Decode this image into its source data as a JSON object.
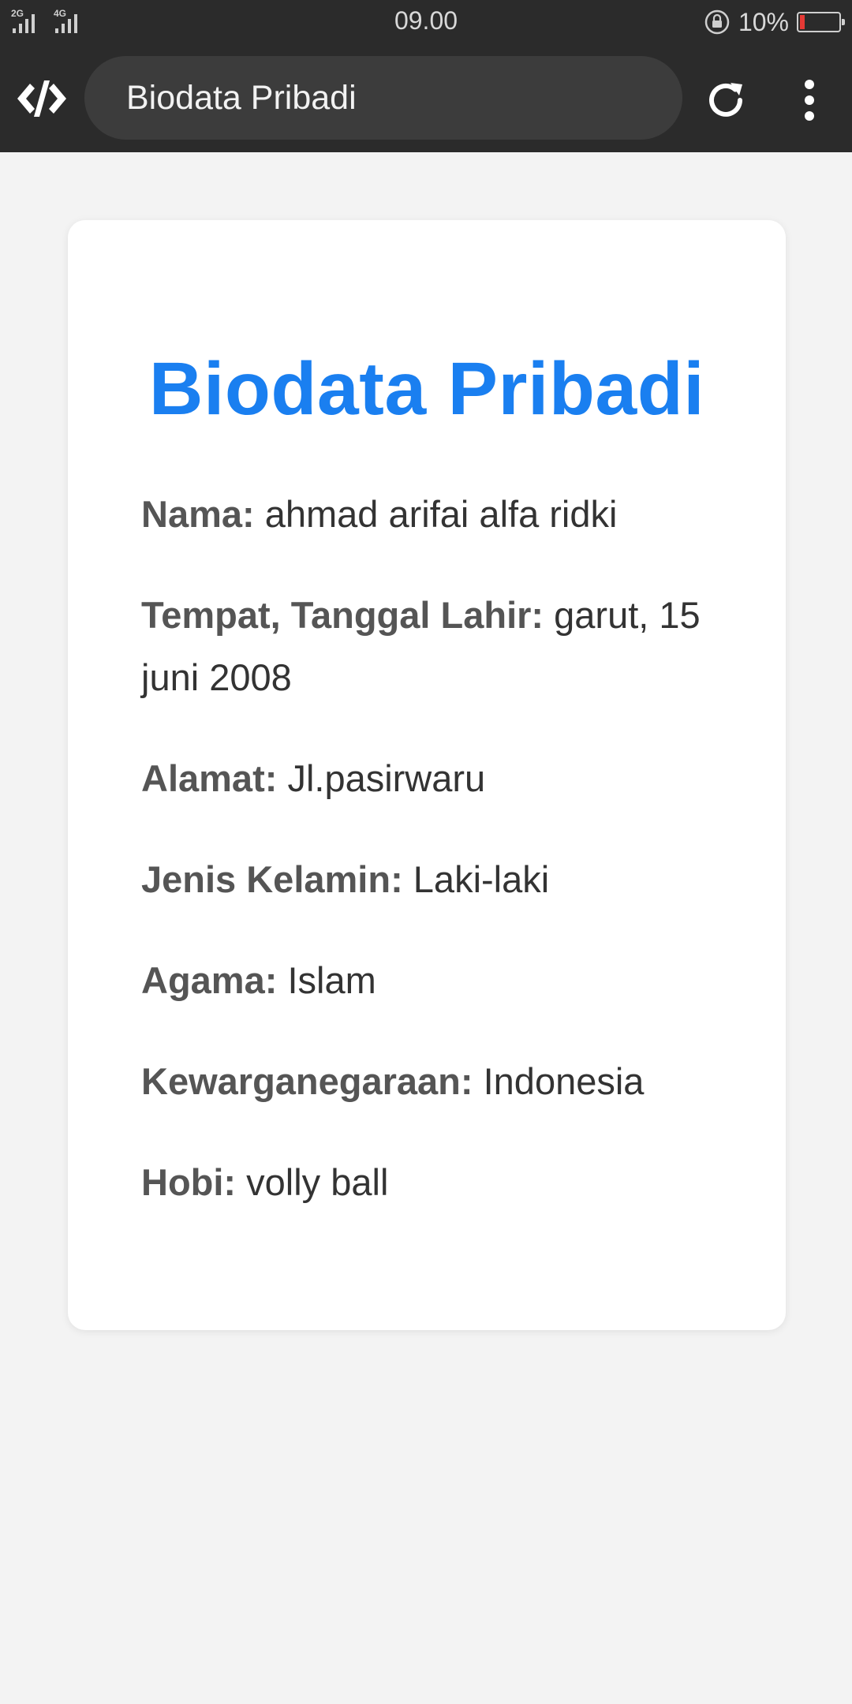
{
  "status_bar": {
    "sim1_network": "2G",
    "sim2_network": "4G",
    "time": "09.00",
    "battery": "10%"
  },
  "browser": {
    "url_title": "Biodata Pribadi"
  },
  "page": {
    "title": "Biodata Pribadi",
    "fields": [
      {
        "label": "Nama:",
        "value": "ahmad arifai alfa ridki"
      },
      {
        "label": "Tempat, Tanggal Lahir:",
        "value": "garut, 15 juni 2008"
      },
      {
        "label": "Alamat:",
        "value": "Jl.pasirwaru"
      },
      {
        "label": "Jenis Kelamin:",
        "value": "Laki-laki"
      },
      {
        "label": "Agama:",
        "value": "Islam"
      },
      {
        "label": "Kewarganegaraan:",
        "value": "Indonesia"
      },
      {
        "label": "Hobi:",
        "value": "volly ball"
      }
    ]
  },
  "colors": {
    "title": "#1a7ff0",
    "toolbar": "#2b2b2b",
    "battery_low": "#e53935"
  },
  "icons": [
    "signal-icon",
    "lock-rotation-icon",
    "battery-icon",
    "app-logo-icon",
    "reload-icon",
    "more-vert-icon"
  ]
}
